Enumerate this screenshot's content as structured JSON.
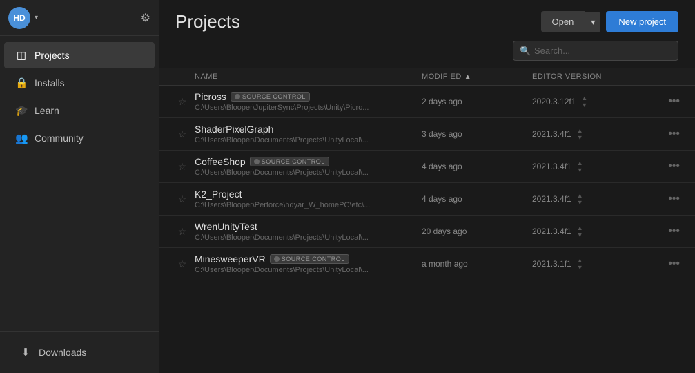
{
  "sidebar": {
    "avatar": {
      "initials": "HD",
      "color": "#4a90d9"
    },
    "nav_items": [
      {
        "id": "projects",
        "label": "Projects",
        "icon": "◈",
        "active": true
      },
      {
        "id": "installs",
        "label": "Installs",
        "icon": "🔒",
        "active": false
      },
      {
        "id": "learn",
        "label": "Learn",
        "icon": "🎓",
        "active": false
      },
      {
        "id": "community",
        "label": "Community",
        "icon": "👥",
        "active": false
      }
    ],
    "bottom_items": [
      {
        "id": "downloads",
        "label": "Downloads",
        "icon": "⬇",
        "active": false
      }
    ]
  },
  "header": {
    "title": "Projects",
    "open_label": "Open",
    "dropdown_label": "▾",
    "new_project_label": "New project"
  },
  "search": {
    "placeholder": "Search..."
  },
  "table": {
    "columns": {
      "name": "NAME",
      "modified": "MODIFIED",
      "editor_version": "EDITOR VERSION"
    },
    "sort_indicator": "▲"
  },
  "projects": [
    {
      "name": "Picross",
      "path": "C:\\Users\\Blooper\\JupiterSync\\Projects\\Unity\\Picro...",
      "modified": "2 days ago",
      "editor_version": "2020.3.12f1",
      "source_control": true,
      "starred": false
    },
    {
      "name": "ShaderPixelGraph",
      "path": "C:\\Users\\Blooper\\Documents\\Projects\\UnityLocal\\...",
      "modified": "3 days ago",
      "editor_version": "2021.3.4f1",
      "source_control": false,
      "starred": false
    },
    {
      "name": "CoffeeShop",
      "path": "C:\\Users\\Blooper\\Documents\\Projects\\UnityLocal\\...",
      "modified": "4 days ago",
      "editor_version": "2021.3.4f1",
      "source_control": true,
      "starred": false
    },
    {
      "name": "K2_Project",
      "path": "C:\\Users\\Blooper\\Perforce\\hdyar_W_homePC\\etc\\...",
      "modified": "4 days ago",
      "editor_version": "2021.3.4f1",
      "source_control": false,
      "starred": false
    },
    {
      "name": "WrenUnityTest",
      "path": "C:\\Users\\Blooper\\Documents\\Projects\\UnityLocal\\...",
      "modified": "20 days ago",
      "editor_version": "2021.3.4f1",
      "source_control": false,
      "starred": false
    },
    {
      "name": "MinesweeperVR",
      "path": "C:\\Users\\Blooper\\Documents\\Projects\\UnityLocal\\...",
      "modified": "a month ago",
      "editor_version": "2021.3.1f1",
      "source_control": true,
      "starred": false
    }
  ]
}
